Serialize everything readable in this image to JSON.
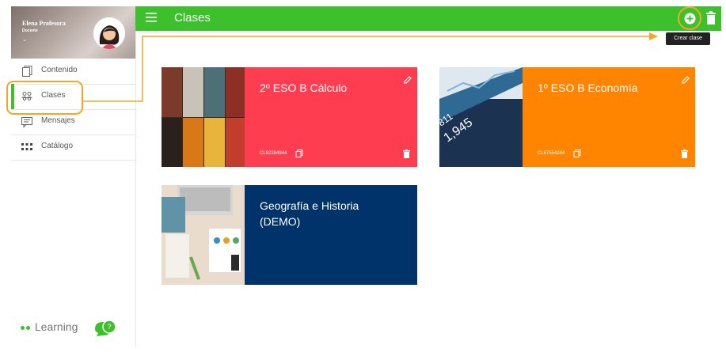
{
  "user": {
    "name": "Elena Profesora",
    "role": "Docente"
  },
  "nav": [
    {
      "label": "Contenido",
      "icon": "book-icon"
    },
    {
      "label": "Clases",
      "icon": "users-icon",
      "active": true
    },
    {
      "label": "Mensajes",
      "icon": "chat-icon"
    },
    {
      "label": "Catálogo",
      "icon": "grid-icon"
    }
  ],
  "brand": {
    "name": "Learning"
  },
  "header": {
    "title": "Clases",
    "add_tooltip": "Crear clase"
  },
  "classes": [
    {
      "title": "2º ESO B Cálculo",
      "code": "CL92284944",
      "color": "#ff3d50",
      "image": "lockers-photo"
    },
    {
      "title": "1º ESO B Economía",
      "code": "CL67554244",
      "color": "#ff8400",
      "image": "stats-screen-photo"
    },
    {
      "title": "Geografía e Historia (DEMO)",
      "code": "",
      "color": "#003369",
      "image": "desk-photo"
    }
  ],
  "colors": {
    "accent": "#3cc12c",
    "highlight": "#f5a623"
  }
}
